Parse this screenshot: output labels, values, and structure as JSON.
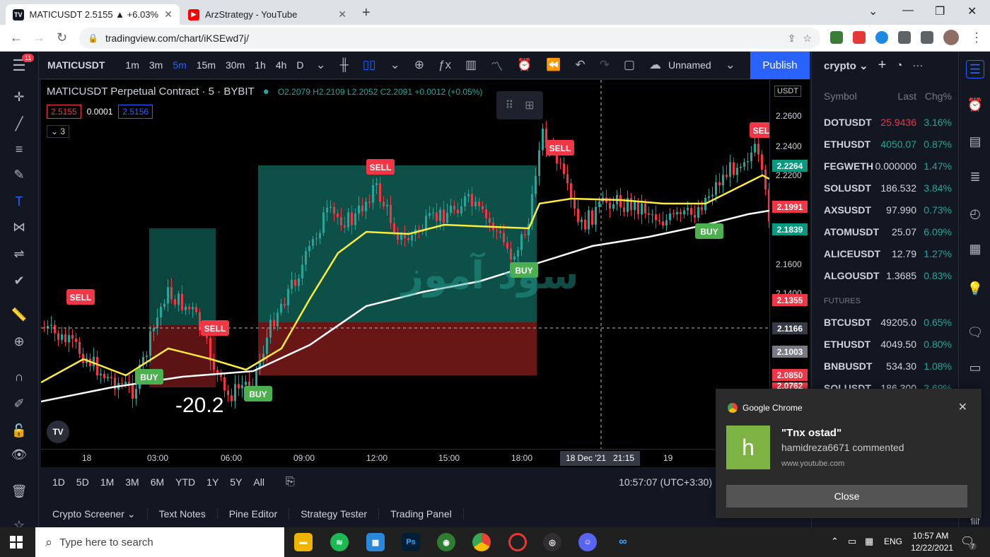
{
  "browser": {
    "tabs": [
      {
        "title": "MATICUSDT 2.5155 ▲ +6.03% U",
        "active": true
      },
      {
        "title": "ArzStrategy - YouTube",
        "active": false
      }
    ],
    "url": "tradingview.com/chart/iKSEwd7j/"
  },
  "toolbar": {
    "symbol": "MATICUSDT",
    "intervals": [
      "1m",
      "3m",
      "5m",
      "15m",
      "30m",
      "1h",
      "4h",
      "D"
    ],
    "active_interval": "5m",
    "layout_name": "Unnamed",
    "publish": "Publish"
  },
  "legend": {
    "title": "MATICUSDT Perpetual Contract · 5 · BYBIT",
    "ohlc": "O2.2079 H2.2109 L2.2052 C2.2091 +0.0012 (+0.05%)",
    "bid": "2.5155",
    "spread": "0.0001",
    "ask": "2.5156",
    "indicators_count": "3"
  },
  "chart_labels": {
    "sell": "SELL",
    "buy": "BUY",
    "pnl": "-20.2",
    "currency": "USDT",
    "watermark": "سود آموز"
  },
  "price_axis": {
    "ticks": [
      "2.2600",
      "2.2400",
      "2.2200",
      "2.1600",
      "2.1400"
    ],
    "labels": [
      {
        "v": "2.2264",
        "c": "#089981"
      },
      {
        "v": "2.1991",
        "c": "#f23645"
      },
      {
        "v": "2.1839",
        "c": "#089981"
      },
      {
        "v": "2.1355",
        "c": "#f23645"
      },
      {
        "v": "2.1166",
        "c": "#363a45"
      },
      {
        "v": "2.1003",
        "c": "#787b86"
      },
      {
        "v": "2.0850",
        "c": "#f23645"
      },
      {
        "v": "2.0762",
        "c": "#f23645"
      }
    ]
  },
  "time_axis": {
    "ticks": [
      "18",
      "03:00",
      "06:00",
      "09:00",
      "12:00",
      "15:00",
      "18:00",
      "19"
    ],
    "crosshair": "18 Dec '21   21:15"
  },
  "range_bar": {
    "ranges": [
      "1D",
      "5D",
      "1M",
      "3M",
      "6M",
      "YTD",
      "1Y",
      "5Y",
      "All"
    ],
    "clock": "10:57:07 (UTC+3:30)"
  },
  "bottom_tabs": [
    "Crypto Screener",
    "Text Notes",
    "Pine Editor",
    "Strategy Tester",
    "Trading Panel"
  ],
  "watchlist": {
    "name": "crypto",
    "col_symbol": "Symbol",
    "col_last": "Last",
    "col_chg": "Chg%",
    "section_futures": "FUTURES",
    "rows": [
      {
        "s": "DOTUSDT",
        "l": "25.9436",
        "c": "3.16%",
        "lc": "#f23645"
      },
      {
        "s": "ETHUSDT",
        "l": "4050.07",
        "c": "0.87%",
        "lc": "#26a69a"
      },
      {
        "s": "FEGWETH",
        "l": "0.000000",
        "c": "1.47%",
        "lc": "#d1d4dc"
      },
      {
        "s": "SOLUSDT",
        "l": "186.532",
        "c": "3.84%",
        "lc": "#d1d4dc"
      },
      {
        "s": "AXSUSDT",
        "l": "97.990",
        "c": "0.73%",
        "lc": "#d1d4dc"
      },
      {
        "s": "ATOMUSDT",
        "l": "25.07",
        "c": "6.09%",
        "lc": "#d1d4dc"
      },
      {
        "s": "ALICEUSDT",
        "l": "12.79",
        "c": "1.27%",
        "lc": "#d1d4dc"
      },
      {
        "s": "ALGOUSDT",
        "l": "1.3685",
        "c": "0.83%",
        "lc": "#d1d4dc"
      }
    ],
    "futures": [
      {
        "s": "BTCUSDT",
        "l": "49205.0",
        "c": "0.65%",
        "lc": "#d1d4dc"
      },
      {
        "s": "ETHUSDT",
        "l": "4049.50",
        "c": "0.80%",
        "lc": "#d1d4dc"
      },
      {
        "s": "BNBUSDT",
        "l": "534.30",
        "c": "1.08%",
        "lc": "#d1d4dc"
      },
      {
        "s": "SOLUSDT",
        "l": "186.300",
        "c": "3.69%",
        "lc": "#d1d4dc"
      }
    ]
  },
  "notification": {
    "app": "Google Chrome",
    "avatar": "h",
    "title": "\"Tnx ostad\"",
    "body": "hamidreza6671 commented",
    "source": "www.youtube.com",
    "button": "Close"
  },
  "taskbar": {
    "search_placeholder": "Type here to search",
    "lang": "ENG",
    "time": "10:57 AM",
    "date": "12/22/2021",
    "notify_count": "7"
  },
  "colors": {
    "accent": "#2962ff",
    "up": "#26a69a",
    "down": "#f23645",
    "ema": "#ffeb3b",
    "sma": "#ffffff"
  }
}
